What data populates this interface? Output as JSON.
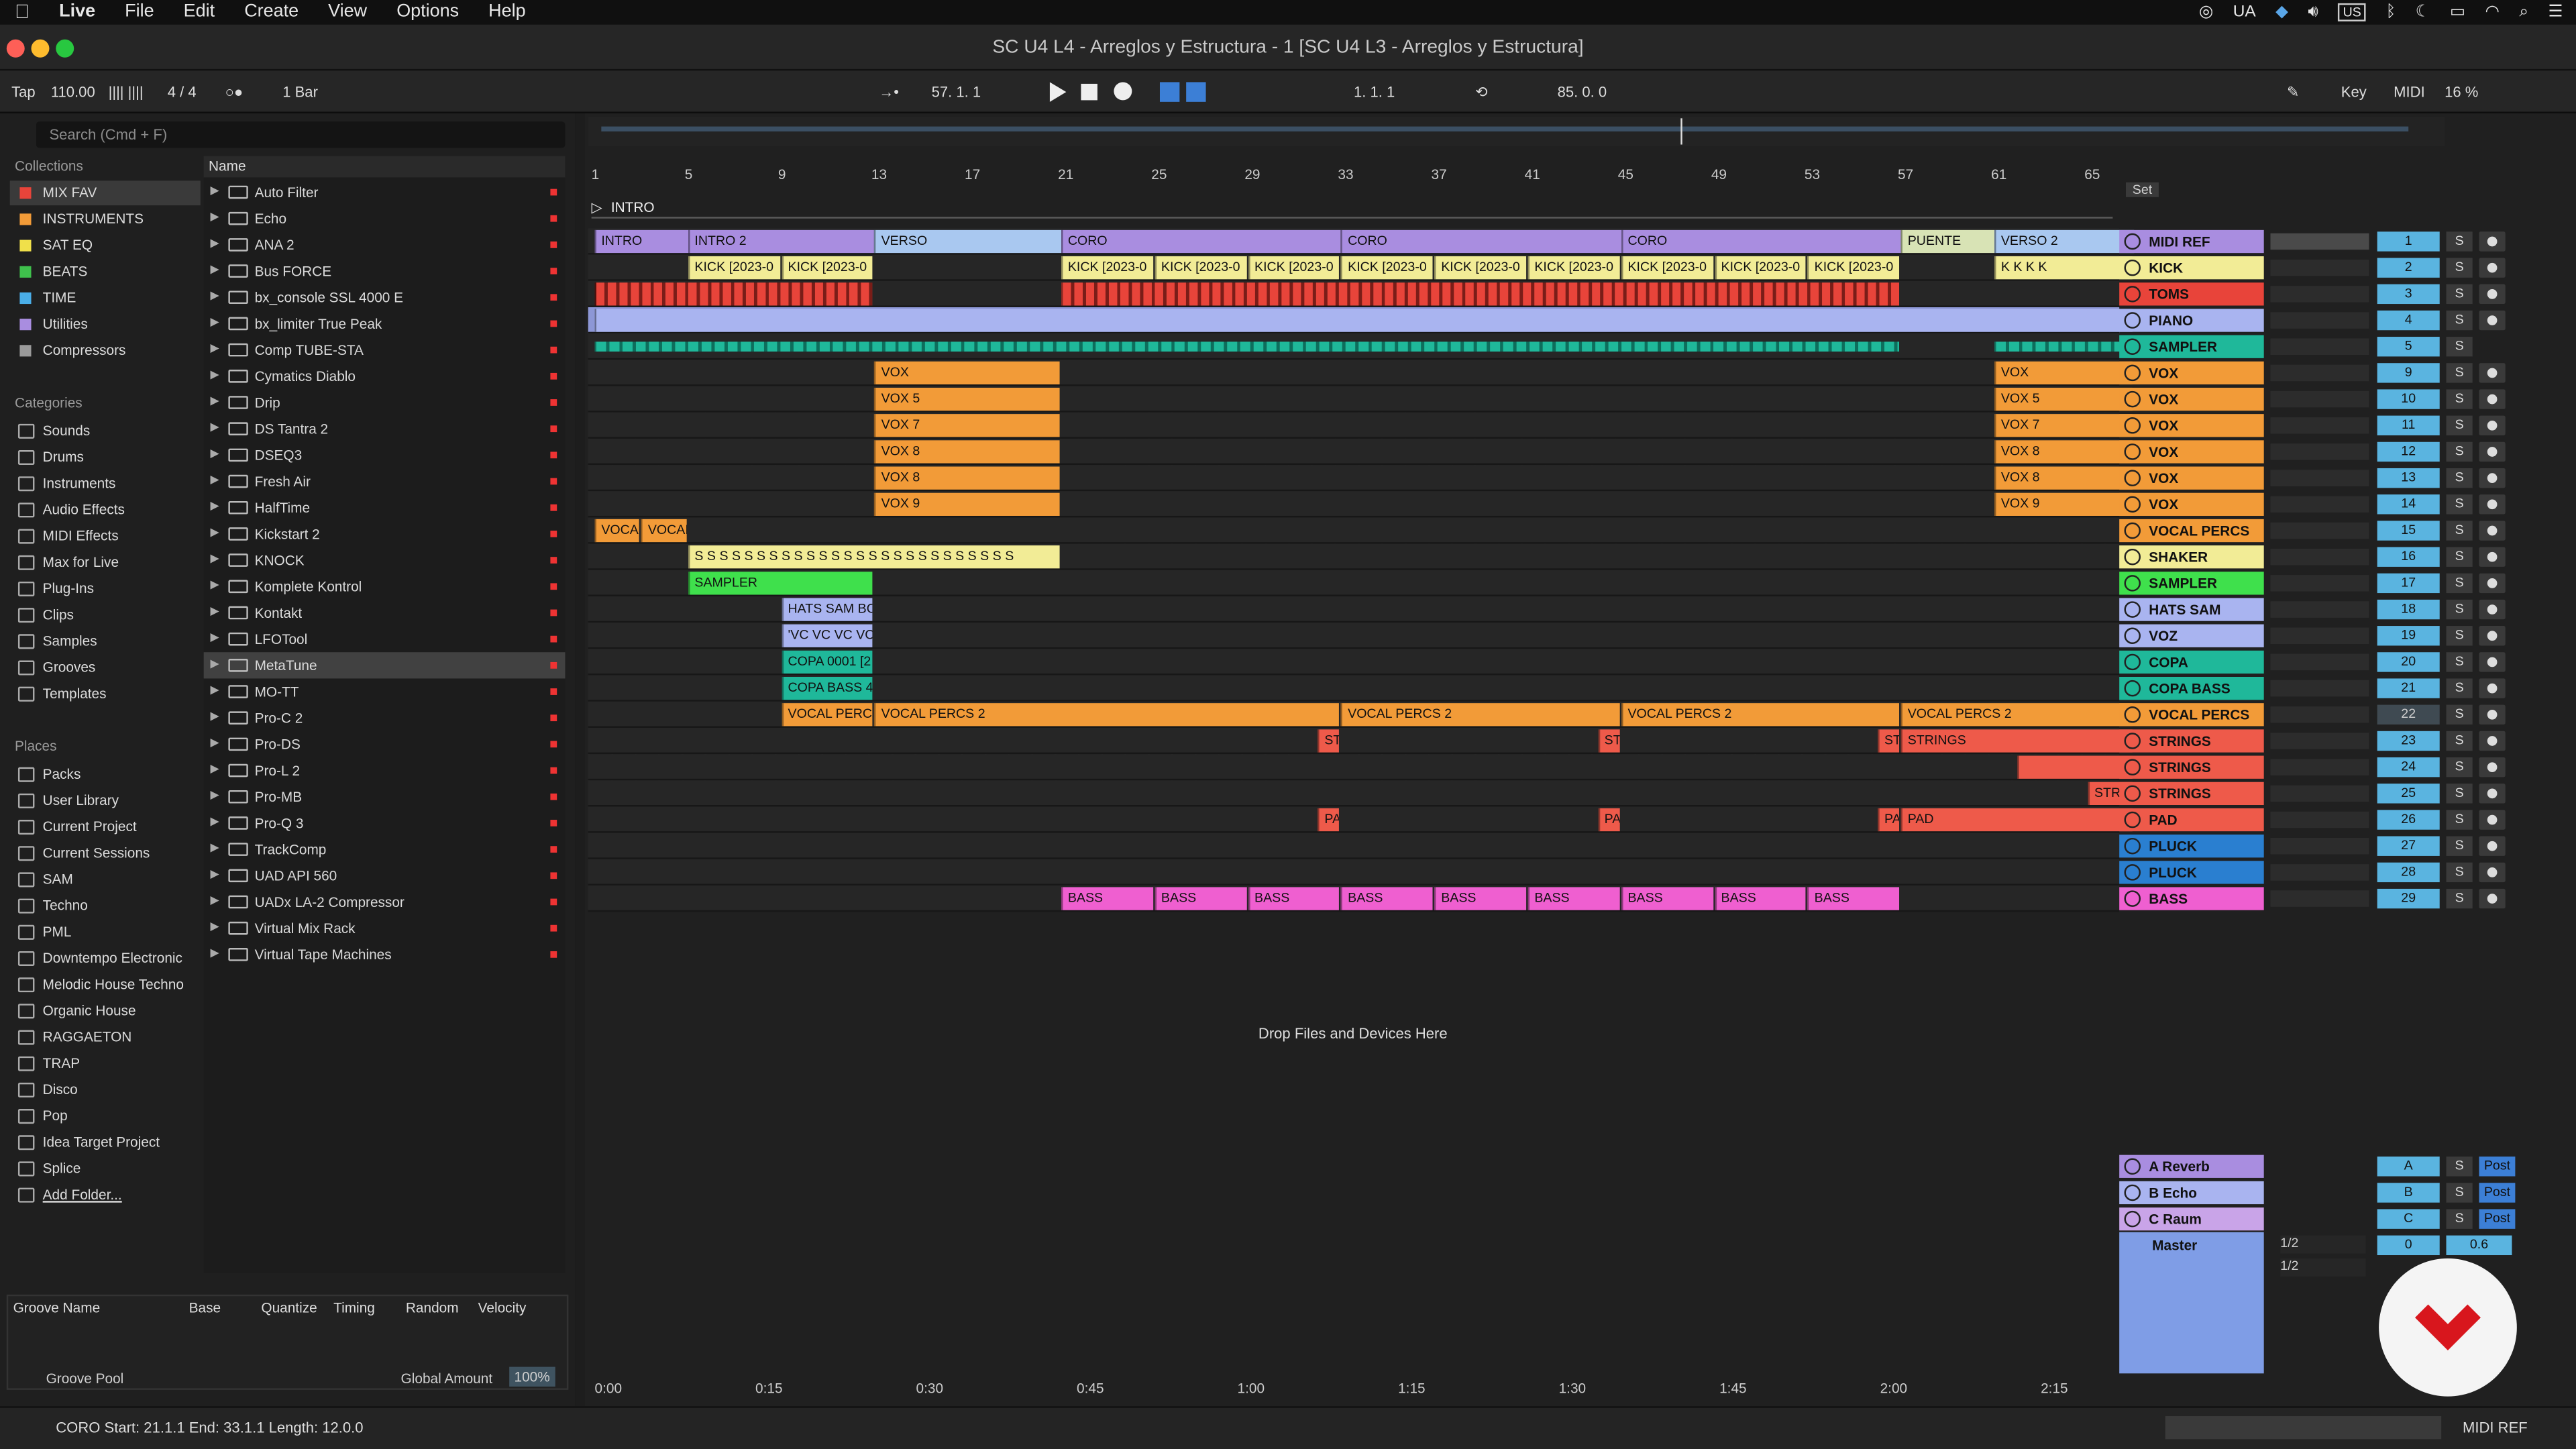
{
  "menubar": {
    "items": [
      "Live",
      "File",
      "Edit",
      "Create",
      "View",
      "Options",
      "Help"
    ],
    "ua": "UA",
    "us": "US"
  },
  "window": {
    "title": "SC U4 L4 - Arreglos y Estructura - 1  [SC U4 L3 - Arreglos y Estructura]"
  },
  "transport": {
    "tap": "Tap",
    "tempo": "110.00",
    "signature": "4 / 4",
    "quantize": "1 Bar",
    "position": "57.   1.   1",
    "loop_start": "1.   1.   1",
    "loop_length": "85.   0.   0",
    "key": "Key",
    "midi": "MIDI",
    "cpu": "16 %"
  },
  "browser": {
    "search_placeholder": "Search (Cmd + F)",
    "collections_header": "Collections",
    "collections": [
      {
        "label": "MIX FAV",
        "color": "#e8443a"
      },
      {
        "label": "INSTRUMENTS",
        "color": "#f29b38"
      },
      {
        "label": "SAT EQ",
        "color": "#f0e04a"
      },
      {
        "label": "BEATS",
        "color": "#3fc04c"
      },
      {
        "label": "TIME",
        "color": "#4aaee8"
      },
      {
        "label": "Utilities",
        "color": "#a98de0"
      },
      {
        "label": "Compressors",
        "color": "#9a9a9a"
      }
    ],
    "categories_header": "Categories",
    "categories": [
      "Sounds",
      "Drums",
      "Instruments",
      "Audio Effects",
      "MIDI Effects",
      "Max for Live",
      "Plug-Ins",
      "Clips",
      "Samples",
      "Grooves",
      "Templates"
    ],
    "places_header": "Places",
    "places": [
      "Packs",
      "User Library",
      "Current Project",
      "Current Sessions",
      "SAM",
      "Techno",
      "PML",
      "Downtempo Electronic",
      "Melodic House Techno",
      "Organic House",
      "RAGGAETON",
      "TRAP",
      "Disco",
      "Pop",
      "Idea Target Project",
      "Splice",
      "Add Folder..."
    ],
    "list_header": "Name",
    "items": [
      "Auto Filter",
      "Echo",
      "ANA 2",
      "Bus FORCE",
      "bx_console SSL 4000 E",
      "bx_limiter True Peak",
      "Comp TUBE-STA",
      "Cymatics Diablo",
      "Drip",
      "DS Tantra 2",
      "DSEQ3",
      "Fresh Air",
      "HalfTime",
      "Kickstart 2",
      "KNOCK",
      "Komplete Kontrol",
      "Kontakt",
      "LFOTool",
      "MetaTune",
      "MO-TT",
      "Pro-C 2",
      "Pro-DS",
      "Pro-L 2",
      "Pro-MB",
      "Pro-Q 3",
      "TrackComp",
      "UAD API 560",
      "UADx LA-2 Compressor",
      "Virtual Mix Rack",
      "Virtual Tape Machines"
    ],
    "selected_item": "MetaTune"
  },
  "groove": {
    "headers": [
      "Groove Name",
      "Base",
      "Quantize",
      "Timing",
      "Random",
      "Velocity"
    ],
    "pool": "Groove Pool",
    "global_amount_label": "Global Amount",
    "global_amount": "100%"
  },
  "arrangement": {
    "ruler": [
      "1",
      "5",
      "9",
      "13",
      "17",
      "21",
      "25",
      "29",
      "33",
      "37",
      "41",
      "45",
      "49",
      "53",
      "57",
      "61",
      "65"
    ],
    "set_label": "Set",
    "locator": "INTRO",
    "sections": [
      {
        "label": "INTRO",
        "start": 1,
        "len": 4
      },
      {
        "label": "INTRO 2",
        "start": 5,
        "len": 8
      },
      {
        "label": "VERSO",
        "start": 13,
        "len": 8
      },
      {
        "label": "CORO",
        "start": 21,
        "len": 12
      },
      {
        "label": "CORO",
        "start": 33,
        "len": 12
      },
      {
        "label": "CORO",
        "start": 45,
        "len": 12
      },
      {
        "label": "PUENTE",
        "start": 57,
        "len": 4
      },
      {
        "label": "VERSO 2",
        "start": 61,
        "len": 6
      }
    ],
    "drop_text": "Drop Files and Devices Here",
    "time_axis": [
      "0:00",
      "0:15",
      "0:30",
      "0:45",
      "1:00",
      "1:15",
      "1:30",
      "1:45",
      "2:00",
      "2:15"
    ],
    "tracks": [
      {
        "name": "MIDI REF",
        "num": "1",
        "color": "#a98de0",
        "sb": "S"
      },
      {
        "name": "KICK",
        "num": "2",
        "color": "#f2ec96",
        "sb": "S"
      },
      {
        "name": "TOMS",
        "num": "3",
        "color": "#e8443a",
        "sb": "S"
      },
      {
        "name": "PIANO",
        "num": "4",
        "color": "#a9b4f0",
        "sb": "S"
      },
      {
        "name": "SAMPLER",
        "num": "5",
        "color": "#1fb89a",
        "sb": "S"
      },
      {
        "name": "VOX",
        "num": "9",
        "color": "#f29b38",
        "sb": "S"
      },
      {
        "name": "VOX",
        "num": "10",
        "color": "#f29b38",
        "sb": "S"
      },
      {
        "name": "VOX",
        "num": "11",
        "color": "#f29b38",
        "sb": "S"
      },
      {
        "name": "VOX",
        "num": "12",
        "color": "#f29b38",
        "sb": "S"
      },
      {
        "name": "VOX",
        "num": "13",
        "color": "#f29b38",
        "sb": "S"
      },
      {
        "name": "VOX",
        "num": "14",
        "color": "#f29b38",
        "sb": "S"
      },
      {
        "name": "VOCAL PERCS",
        "num": "15",
        "color": "#f29b38",
        "sb": "S"
      },
      {
        "name": "SHAKER",
        "num": "16",
        "color": "#f2ec96",
        "sb": "S"
      },
      {
        "name": "SAMPLER",
        "num": "17",
        "color": "#3fe04c",
        "sb": "S"
      },
      {
        "name": "HATS SAM BOJO",
        "num": "18",
        "color": "#a9b4f0",
        "sb": "S"
      },
      {
        "name": "VOZ",
        "num": "19",
        "color": "#a9b4f0",
        "sb": "S"
      },
      {
        "name": "COPA",
        "num": "20",
        "color": "#1fb89a",
        "sb": "S"
      },
      {
        "name": "COPA BASS",
        "num": "21",
        "color": "#1fb89a",
        "sb": "S"
      },
      {
        "name": "VOCAL PERCS",
        "num": "22",
        "color": "#f29b38",
        "sb": "S"
      },
      {
        "name": "STRINGS",
        "num": "23",
        "color": "#ee5a4a",
        "sb": "S"
      },
      {
        "name": "STRINGS",
        "num": "24",
        "color": "#ee5a4a",
        "sb": "S"
      },
      {
        "name": "STRINGS",
        "num": "25",
        "color": "#ee5a4a",
        "sb": "S"
      },
      {
        "name": "PAD",
        "num": "26",
        "color": "#ee5a4a",
        "sb": "S"
      },
      {
        "name": "PLUCK",
        "num": "27",
        "color": "#2a7fd0",
        "sb": "S"
      },
      {
        "name": "PLUCK",
        "num": "28",
        "color": "#2a7fd0",
        "sb": "S"
      },
      {
        "name": "BASS",
        "num": "29",
        "color": "#ef5fd0",
        "sb": "S"
      }
    ],
    "clips": [
      [],
      [
        {
          "label": "KICK [2023-0",
          "start": 5,
          "len": 4
        },
        {
          "label": "KICK [2023-0",
          "start": 9,
          "len": 4
        },
        {
          "label": "KICK [2023-0",
          "start": 21,
          "len": 4
        },
        {
          "label": "KICK [2023-0",
          "start": 25,
          "len": 4
        },
        {
          "label": "KICK [2023-0",
          "start": 29,
          "len": 4
        },
        {
          "label": "KICK [2023-0",
          "start": 33,
          "len": 4
        },
        {
          "label": "KICK [2023-0",
          "start": 37,
          "len": 4
        },
        {
          "label": "KICK [2023-0",
          "start": 41,
          "len": 4
        },
        {
          "label": "KICK [2023-0",
          "start": 45,
          "len": 4
        },
        {
          "label": "KICK [2023-0",
          "start": 49,
          "len": 4
        },
        {
          "label": "KICK [2023-0",
          "start": 53,
          "len": 4
        },
        {
          "label": "K K K K",
          "start": 61,
          "len": 6
        }
      ],
      [
        {
          "label": "",
          "start": 1,
          "len": 12
        },
        {
          "label": "",
          "start": 21,
          "len": 36
        }
      ],
      [
        {
          "label": "",
          "start": 1,
          "len": 66
        }
      ],
      [
        {
          "label": "",
          "start": 1,
          "len": 56
        },
        {
          "label": "",
          "start": 61,
          "len": 6
        }
      ],
      [
        {
          "label": "VOX",
          "start": 13,
          "len": 8
        },
        {
          "label": "VOX",
          "start": 61,
          "len": 6
        }
      ],
      [
        {
          "label": "VOX 5",
          "start": 13,
          "len": 8
        },
        {
          "label": "VOX 5",
          "start": 61,
          "len": 6
        }
      ],
      [
        {
          "label": "VOX 7",
          "start": 13,
          "len": 8
        },
        {
          "label": "VOX 7",
          "start": 61,
          "len": 6
        }
      ],
      [
        {
          "label": "VOX 8",
          "start": 13,
          "len": 8
        },
        {
          "label": "VOX 8",
          "start": 61,
          "len": 6
        }
      ],
      [
        {
          "label": "VOX 8",
          "start": 13,
          "len": 8
        },
        {
          "label": "VOX 8",
          "start": 61,
          "len": 6
        }
      ],
      [
        {
          "label": "VOX 9",
          "start": 13,
          "len": 8
        },
        {
          "label": "VOX 9",
          "start": 61,
          "len": 6
        }
      ],
      [
        {
          "label": "VOCAL",
          "start": 1,
          "len": 2
        },
        {
          "label": "VOCAL",
          "start": 3,
          "len": 2
        }
      ],
      [
        {
          "label": "S S S S S S S S S S S S S S S S S S S S S S S S S S",
          "start": 5,
          "len": 16
        }
      ],
      [
        {
          "label": "SAMPLER",
          "start": 5,
          "len": 8
        }
      ],
      [
        {
          "label": "HATS SAM BO",
          "start": 9,
          "len": 4
        }
      ],
      [
        {
          "label": "'VC VC VC VC",
          "start": 9,
          "len": 4
        }
      ],
      [
        {
          "label": "COPA 0001 [2",
          "start": 9,
          "len": 4
        }
      ],
      [
        {
          "label": "COPA BASS 4",
          "start": 9,
          "len": 4
        }
      ],
      [
        {
          "label": "VOCAL PERCS",
          "start": 9,
          "len": 4
        },
        {
          "label": "VOCAL PERCS 2",
          "start": 13,
          "len": 20
        },
        {
          "label": "VOCAL PERCS 2",
          "start": 33,
          "len": 12
        },
        {
          "label": "VOCAL PERCS 2",
          "start": 45,
          "len": 12
        },
        {
          "label": "VOCAL PERCS 2",
          "start": 57,
          "len": 10
        }
      ],
      [
        {
          "label": "ST",
          "start": 32,
          "len": 1
        },
        {
          "label": "ST",
          "start": 44,
          "len": 1
        },
        {
          "label": "STI",
          "start": 56,
          "len": 1
        },
        {
          "label": "STRINGS",
          "start": 57,
          "len": 10
        }
      ],
      [
        {
          "label": "",
          "start": 62,
          "len": 5
        }
      ],
      [
        {
          "label": "STRIN",
          "start": 65,
          "len": 2
        }
      ],
      [
        {
          "label": "PA",
          "start": 32,
          "len": 1
        },
        {
          "label": "PA",
          "start": 44,
          "len": 1
        },
        {
          "label": "PA",
          "start": 56,
          "len": 1
        },
        {
          "label": "PAD",
          "start": 57,
          "len": 10
        }
      ],
      [],
      [],
      [
        {
          "label": "BASS",
          "start": 21,
          "len": 4
        },
        {
          "label": "BASS",
          "start": 25,
          "len": 4
        },
        {
          "label": "BASS",
          "start": 29,
          "len": 4
        },
        {
          "label": "BASS",
          "start": 33,
          "len": 4
        },
        {
          "label": "BASS",
          "start": 37,
          "len": 4
        },
        {
          "label": "BASS",
          "start": 41,
          "len": 4
        },
        {
          "label": "BASS",
          "start": 45,
          "len": 4
        },
        {
          "label": "BASS",
          "start": 49,
          "len": 4
        },
        {
          "label": "BASS",
          "start": 53,
          "len": 4
        }
      ]
    ],
    "returns": [
      {
        "name": "A Reverb",
        "letter": "A",
        "color": "#a98de0"
      },
      {
        "name": "B Echo",
        "letter": "B",
        "color": "#a9b4f0"
      },
      {
        "name": "C Raum",
        "letter": "C",
        "color": "#c9a4e8"
      }
    ],
    "master": {
      "name": "Master",
      "color": "#7f9de6",
      "value": "0",
      "gain": "0.6",
      "post": "Post",
      "cue1": "1/2",
      "cue2": "1/2"
    }
  },
  "status_bar": {
    "text": "CORO  Start: 21.1.1  End: 33.1.1  Length: 12.0.0",
    "right": "MIDI REF"
  }
}
